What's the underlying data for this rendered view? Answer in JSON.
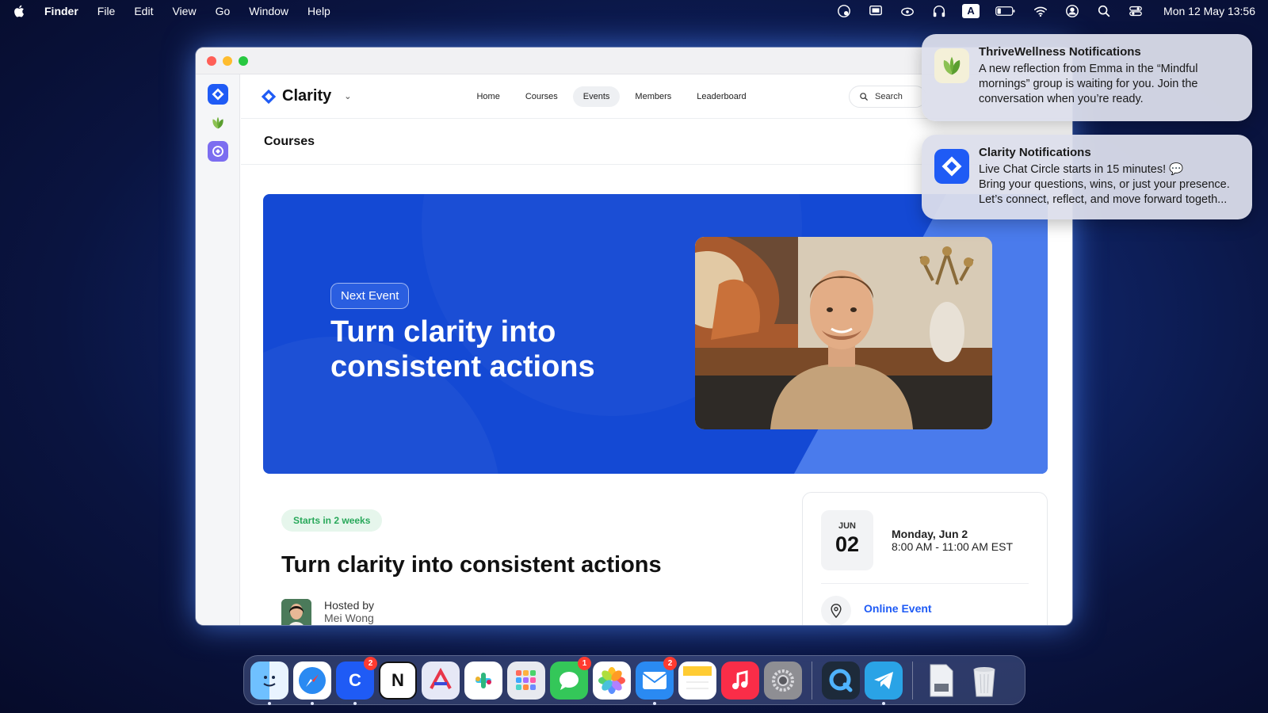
{
  "menubar": {
    "app_name": "Finder",
    "menus": [
      "File",
      "Edit",
      "View",
      "Go",
      "Window",
      "Help"
    ],
    "clock": "Mon 12 May  13:56",
    "status_icons": [
      "creative-cloud-icon",
      "screen-mirror-icon",
      "cloud-sync-icon",
      "headphones-icon",
      "input-source-icon",
      "battery-icon",
      "wifi-icon",
      "user-icon",
      "spotlight-icon",
      "control-center-icon"
    ],
    "input_source_label": "A"
  },
  "window": {
    "rail_apps": [
      "clarity-app-icon",
      "thrivewellness-app-icon",
      "community-app-icon"
    ]
  },
  "app_header": {
    "brand": "Clarity",
    "nav": [
      "Home",
      "Courses",
      "Events",
      "Members",
      "Leaderboard"
    ],
    "active_nav": "Events",
    "search_placeholder": "Search"
  },
  "page": {
    "title": "Courses"
  },
  "hero": {
    "badge": "Next Event",
    "heading": "Turn clarity into consistent actions"
  },
  "event": {
    "starts_pill": "Starts in 2 weeks",
    "title": "Turn clarity into consistent actions",
    "hosted_by_label": "Hosted by",
    "host_name": "Mei Wong",
    "date_month": "JUN",
    "date_day": "02",
    "date_label": "Monday, Jun 2",
    "time_range": "8:00 AM - 11:00 AM EST",
    "location": "Online Event"
  },
  "notifications": [
    {
      "app": "ThriveWellness Notifications",
      "body": "A new reflection from Emma in the “Mindful mornings” group is waiting for you. Join the conversation when you’re ready."
    },
    {
      "app": "Clarity Notifications",
      "body_line1": "Live Chat Circle starts in 15 minutes! 💬",
      "body_line2": "Bring your questions, wins, or just your presence. Let’s connect, reflect, and move forward togeth..."
    }
  ],
  "dock": {
    "apps": [
      {
        "name": "Finder",
        "badge": ""
      },
      {
        "name": "Safari",
        "badge": ""
      },
      {
        "name": "Clarity",
        "badge": "2"
      },
      {
        "name": "Notion",
        "badge": ""
      },
      {
        "name": "Craft",
        "badge": ""
      },
      {
        "name": "Slack",
        "badge": ""
      },
      {
        "name": "Launchpad",
        "badge": ""
      },
      {
        "name": "Messages",
        "badge": "1"
      },
      {
        "name": "Photos",
        "badge": ""
      },
      {
        "name": "Mail",
        "badge": "2"
      },
      {
        "name": "Notes",
        "badge": ""
      },
      {
        "name": "Music",
        "badge": ""
      },
      {
        "name": "System Settings",
        "badge": ""
      },
      {
        "name": "QuickTime",
        "badge": ""
      },
      {
        "name": "Telegram",
        "badge": ""
      },
      {
        "name": "Documents",
        "badge": ""
      },
      {
        "name": "Trash",
        "badge": ""
      }
    ],
    "notion_label": "N",
    "clarity_label": "C"
  },
  "colors": {
    "brand_blue": "#1f5bf5",
    "hero_blue": "#1449d4",
    "success_green": "#28a85a",
    "badge_red": "#ff3b30"
  }
}
